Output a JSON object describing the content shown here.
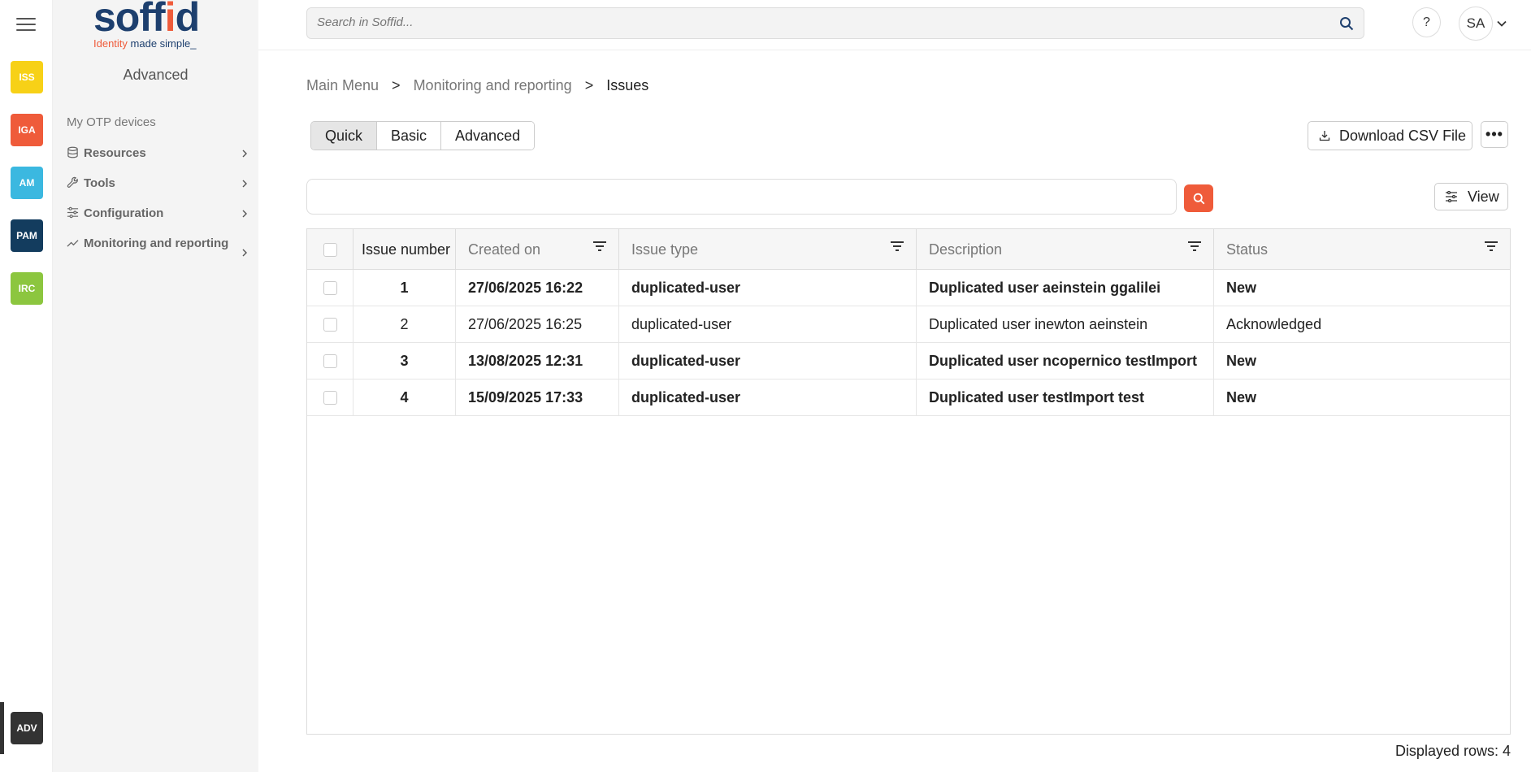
{
  "rail": {
    "apps": [
      {
        "label": "ISS",
        "color": "#f7d117"
      },
      {
        "label": "IGA",
        "color": "#ef5b3a"
      },
      {
        "label": "AM",
        "color": "#3bb8e0"
      },
      {
        "label": "PAM",
        "color": "#133c5e"
      },
      {
        "label": "IRC",
        "color": "#8cc63f"
      }
    ],
    "active_app": {
      "label": "ADV",
      "color": "#333333"
    }
  },
  "sidebar": {
    "logo_text_main": "soff",
    "logo_text_accent": "i",
    "logo_text_end": "d",
    "logo_tagline_1": "Identity",
    "logo_tagline_2": " made simple_",
    "section_title": "Advanced",
    "plain_item": "My OTP devices",
    "items": [
      {
        "label": "Resources",
        "icon": "database-icon"
      },
      {
        "label": "Tools",
        "icon": "wrench-icon"
      },
      {
        "label": "Configuration",
        "icon": "sliders-icon"
      },
      {
        "label": "Monitoring and reporting",
        "icon": "trend-icon"
      }
    ]
  },
  "topbar": {
    "search_placeholder": "Search in Soffid...",
    "help_label": "?",
    "user_initials": "SA"
  },
  "breadcrumb": {
    "items": [
      "Main Menu",
      "Monitoring and reporting"
    ],
    "separator": ">",
    "current": "Issues"
  },
  "toolbar": {
    "modes": [
      "Quick",
      "Basic",
      "Advanced"
    ],
    "active_mode": "Quick",
    "csv_label": "Download CSV File",
    "more_label": "•••",
    "view_label": "View",
    "query_value": ""
  },
  "table": {
    "columns": [
      {
        "key": "issue_number",
        "label": "Issue number"
      },
      {
        "key": "created_on",
        "label": "Created on"
      },
      {
        "key": "issue_type",
        "label": "Issue type"
      },
      {
        "key": "description",
        "label": "Description"
      },
      {
        "key": "status",
        "label": "Status"
      }
    ],
    "sort_indicator": "▲",
    "rows": [
      {
        "issue_number": "1",
        "created_on": "27/06/2025 16:22",
        "issue_type": "duplicated-user",
        "description": "Duplicated user aeinstein ggalilei",
        "status": "New",
        "bold": true
      },
      {
        "issue_number": "2",
        "created_on": "27/06/2025 16:25",
        "issue_type": "duplicated-user",
        "description": "Duplicated user inewton aeinstein",
        "status": "Acknowledged",
        "bold": false
      },
      {
        "issue_number": "3",
        "created_on": "13/08/2025 12:31",
        "issue_type": "duplicated-user",
        "description": "Duplicated user ncopernico testImport",
        "status": "New",
        "bold": true
      },
      {
        "issue_number": "4",
        "created_on": "15/09/2025 17:33",
        "issue_type": "duplicated-user",
        "description": "Duplicated user testImport test",
        "status": "New",
        "bold": true
      }
    ],
    "footer": "Displayed rows: 4"
  }
}
